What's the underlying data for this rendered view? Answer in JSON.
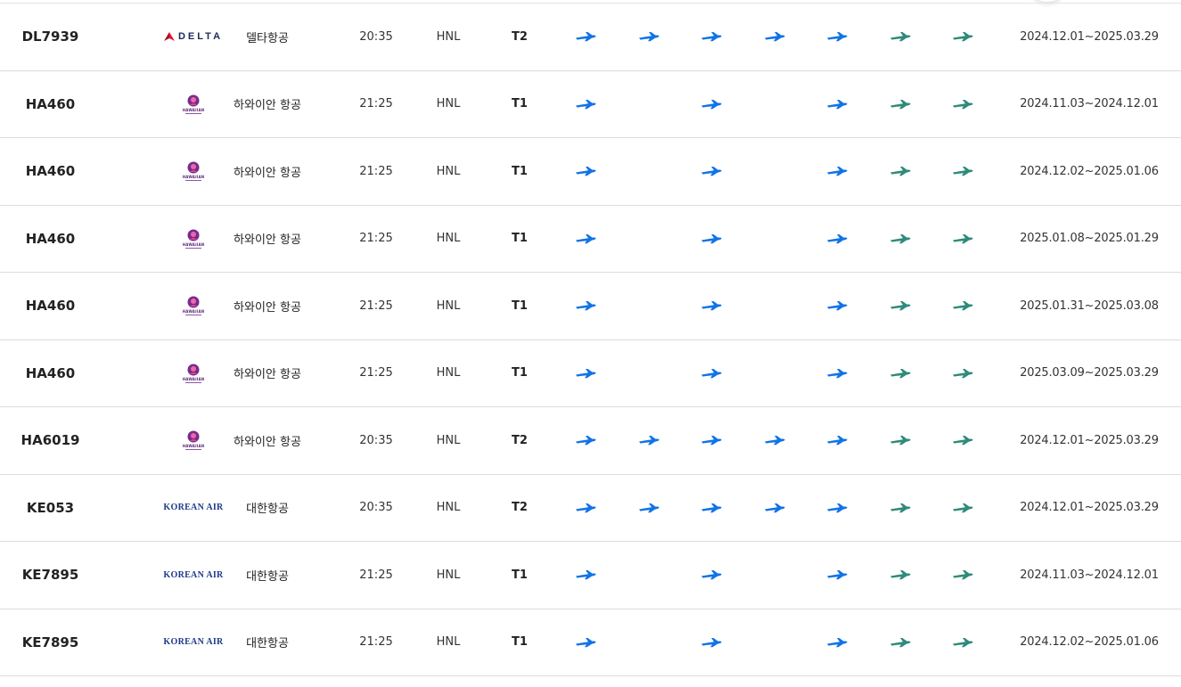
{
  "colors": {
    "plane_blue": "#1173e6",
    "plane_teal": "#2e8a7a"
  },
  "airline_logos": {
    "delta": "DELTA",
    "hawaiian": "HAWAIIAN",
    "korean": "KOREAN AIR"
  },
  "rows": [
    {
      "flight": "DL7939",
      "logo": "delta",
      "airline": "델타항공",
      "time": "20:35",
      "dest": "HNL",
      "terminal": "T2",
      "days": [
        1,
        1,
        1,
        1,
        1,
        1,
        1
      ],
      "period": "2024.12.01~2025.03.29"
    },
    {
      "flight": "HA460",
      "logo": "hawaiian",
      "airline": "하와이안 항공",
      "time": "21:25",
      "dest": "HNL",
      "terminal": "T1",
      "days": [
        1,
        0,
        1,
        0,
        1,
        1,
        1
      ],
      "period": "2024.11.03~2024.12.01"
    },
    {
      "flight": "HA460",
      "logo": "hawaiian",
      "airline": "하와이안 항공",
      "time": "21:25",
      "dest": "HNL",
      "terminal": "T1",
      "days": [
        1,
        0,
        1,
        0,
        1,
        1,
        1
      ],
      "period": "2024.12.02~2025.01.06"
    },
    {
      "flight": "HA460",
      "logo": "hawaiian",
      "airline": "하와이안 항공",
      "time": "21:25",
      "dest": "HNL",
      "terminal": "T1",
      "days": [
        1,
        0,
        1,
        0,
        1,
        1,
        1
      ],
      "period": "2025.01.08~2025.01.29"
    },
    {
      "flight": "HA460",
      "logo": "hawaiian",
      "airline": "하와이안 항공",
      "time": "21:25",
      "dest": "HNL",
      "terminal": "T1",
      "days": [
        1,
        0,
        1,
        0,
        1,
        1,
        1
      ],
      "period": "2025.01.31~2025.03.08"
    },
    {
      "flight": "HA460",
      "logo": "hawaiian",
      "airline": "하와이안 항공",
      "time": "21:25",
      "dest": "HNL",
      "terminal": "T1",
      "days": [
        1,
        0,
        1,
        0,
        1,
        1,
        1
      ],
      "period": "2025.03.09~2025.03.29"
    },
    {
      "flight": "HA6019",
      "logo": "hawaiian",
      "airline": "하와이안 항공",
      "time": "20:35",
      "dest": "HNL",
      "terminal": "T2",
      "days": [
        1,
        1,
        1,
        1,
        1,
        1,
        1
      ],
      "period": "2024.12.01~2025.03.29"
    },
    {
      "flight": "KE053",
      "logo": "korean",
      "airline": "대한항공",
      "time": "20:35",
      "dest": "HNL",
      "terminal": "T2",
      "days": [
        1,
        1,
        1,
        1,
        1,
        1,
        1
      ],
      "period": "2024.12.01~2025.03.29"
    },
    {
      "flight": "KE7895",
      "logo": "korean",
      "airline": "대한항공",
      "time": "21:25",
      "dest": "HNL",
      "terminal": "T1",
      "days": [
        1,
        0,
        1,
        0,
        1,
        1,
        1
      ],
      "period": "2024.11.03~2024.12.01"
    },
    {
      "flight": "KE7895",
      "logo": "korean",
      "airline": "대한항공",
      "time": "21:25",
      "dest": "HNL",
      "terminal": "T1",
      "days": [
        1,
        0,
        1,
        0,
        1,
        1,
        1
      ],
      "period": "2024.12.02~2025.01.06"
    }
  ]
}
